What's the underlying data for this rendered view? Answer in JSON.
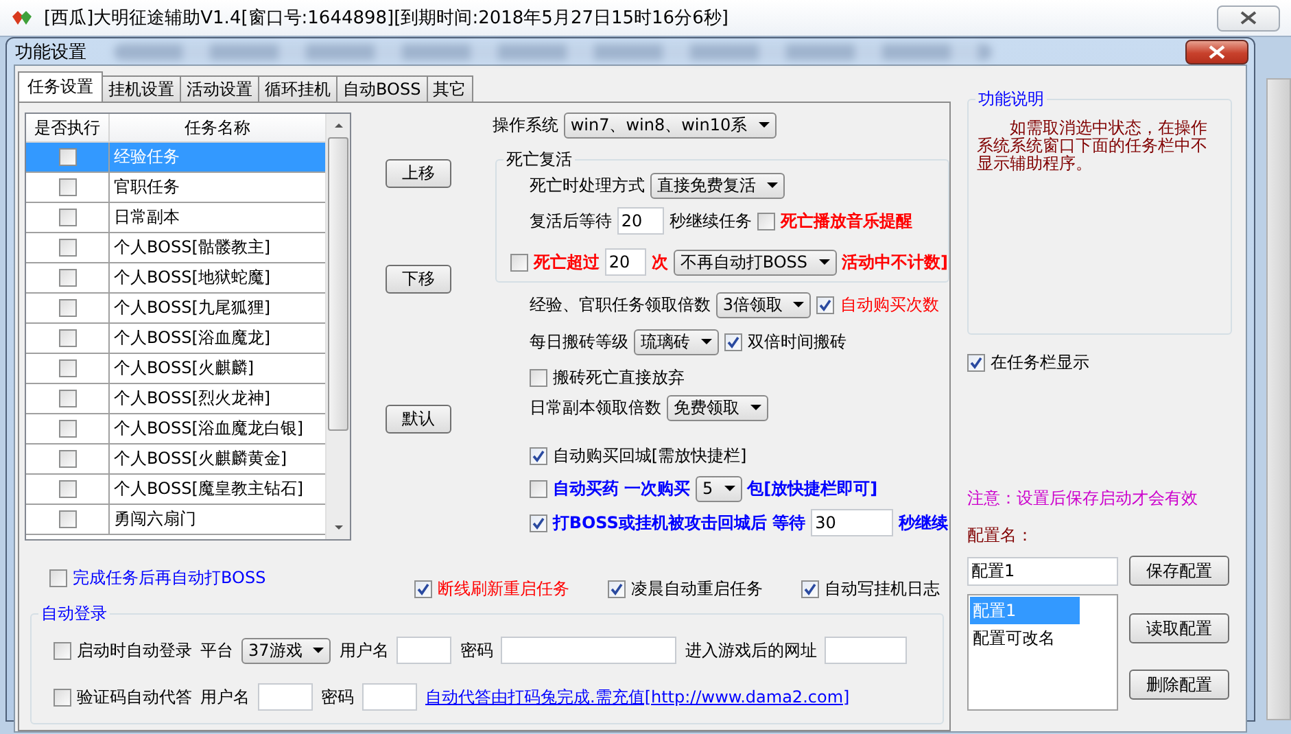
{
  "window": {
    "title": "[西瓜]大明征途辅助V1.4[窗口号:1644898][到期时间:2018年5月27日15时16分6秒]"
  },
  "dialog": {
    "title": "功能设置"
  },
  "tabs": [
    {
      "label": "任务设置",
      "selected": true
    },
    {
      "label": "挂机设置",
      "selected": false
    },
    {
      "label": "活动设置",
      "selected": false
    },
    {
      "label": "循环挂机",
      "selected": false
    },
    {
      "label": "自动BOSS",
      "selected": false
    },
    {
      "label": "其它",
      "selected": false
    }
  ],
  "task_table": {
    "columns": [
      "是否执行",
      "任务名称"
    ],
    "rows": [
      {
        "checked": false,
        "name": "经验任务",
        "selected": true
      },
      {
        "checked": false,
        "name": "官职任务",
        "selected": false
      },
      {
        "checked": false,
        "name": "日常副本",
        "selected": false
      },
      {
        "checked": false,
        "name": "个人BOSS[骷髅教主]",
        "selected": false
      },
      {
        "checked": false,
        "name": "个人BOSS[地狱蛇魔]",
        "selected": false
      },
      {
        "checked": false,
        "name": "个人BOSS[九尾狐狸]",
        "selected": false
      },
      {
        "checked": false,
        "name": "个人BOSS[浴血魔龙]",
        "selected": false
      },
      {
        "checked": false,
        "name": "个人BOSS[火麒麟]",
        "selected": false
      },
      {
        "checked": false,
        "name": "个人BOSS[烈火龙神]",
        "selected": false
      },
      {
        "checked": false,
        "name": "个人BOSS[浴血魔龙白银]",
        "selected": false
      },
      {
        "checked": false,
        "name": "个人BOSS[火麒麟黄金]",
        "selected": false
      },
      {
        "checked": false,
        "name": "个人BOSS[魔皇教主钻石]",
        "selected": false
      },
      {
        "checked": false,
        "name": "勇闯六扇门",
        "selected": false
      }
    ]
  },
  "move_buttons": [
    "上移",
    "下移",
    "默认"
  ],
  "finish_boss": {
    "label": "完成任务后再自动打BOSS",
    "checked": false,
    "color": "#0000ff"
  },
  "settings": [
    {
      "kind": "row",
      "parts": [
        {
          "kind": "label",
          "text": "操作系统"
        },
        {
          "kind": "select",
          "value": "win7、win8、win10系"
        }
      ]
    },
    {
      "kind": "group",
      "legend": "死亡复活",
      "rows": [
        {
          "parts": [
            {
              "kind": "label",
              "text": "死亡时处理方式"
            },
            {
              "kind": "select",
              "value": "直接免费复活"
            }
          ]
        },
        {
          "parts": [
            {
              "kind": "label",
              "text": "复活后等待"
            },
            {
              "kind": "input",
              "value": "20"
            },
            {
              "kind": "label",
              "text": "秒继续任务"
            },
            {
              "kind": "check",
              "checked": false,
              "label": "死亡播放音乐提醒",
              "color": "#ff0000",
              "bold": true
            }
          ]
        },
        {
          "parts": [
            {
              "kind": "check",
              "checked": false
            },
            {
              "kind": "label",
              "text": "死亡超过",
              "color": "#ff0000",
              "bold": true
            },
            {
              "kind": "input",
              "value": "20"
            },
            {
              "kind": "label",
              "text": "次",
              "color": "#ff0000",
              "bold": true
            },
            {
              "kind": "select",
              "value": "不再自动打BOSS"
            },
            {
              "kind": "label",
              "text": "活动中不计数]",
              "color": "#ff0000",
              "bold": true
            }
          ]
        }
      ]
    },
    {
      "kind": "row",
      "parts": [
        {
          "kind": "label",
          "text": "经验、官职任务领取倍数"
        },
        {
          "kind": "select",
          "value": "3倍领取"
        },
        {
          "kind": "check",
          "checked": true,
          "label": "自动购买次数",
          "color": "#ff0000"
        }
      ]
    },
    {
      "kind": "row",
      "parts": [
        {
          "kind": "label",
          "text": "每日搬砖等级"
        },
        {
          "kind": "select",
          "value": "琉璃砖"
        },
        {
          "kind": "check",
          "checked": true,
          "label": "双倍时间搬砖"
        }
      ]
    },
    {
      "kind": "row",
      "parts": [
        {
          "kind": "check",
          "checked": false,
          "label": "搬砖死亡直接放弃"
        }
      ]
    },
    {
      "kind": "row",
      "parts": [
        {
          "kind": "label",
          "text": "日常副本领取倍数"
        },
        {
          "kind": "select",
          "value": "免费领取"
        }
      ]
    },
    {
      "kind": "row",
      "parts": [
        {
          "kind": "check",
          "checked": true,
          "label": "自动购买回城[需放快捷栏]"
        }
      ]
    },
    {
      "kind": "row",
      "parts": [
        {
          "kind": "check",
          "checked": false,
          "label": "自动买药 一次购买",
          "color": "#0000ff",
          "bold": true
        },
        {
          "kind": "select",
          "value": "5"
        },
        {
          "kind": "label",
          "text": "包[放快捷栏即可]",
          "color": "#0000ff",
          "bold": true
        }
      ]
    },
    {
      "kind": "row",
      "parts": [
        {
          "kind": "check",
          "checked": true,
          "label": "打BOSS或挂机被攻击回城后 等待",
          "color": "#0000ff",
          "bold": true
        },
        {
          "kind": "input",
          "value": "30"
        },
        {
          "kind": "label",
          "text": "秒继续",
          "color": "#0000ff",
          "bold": true
        }
      ]
    }
  ],
  "restart_checks": [
    {
      "label": "断线刷新重启任务",
      "checked": true,
      "color": "#ff0000"
    },
    {
      "label": "凌晨自动重启任务",
      "checked": true,
      "color": "#000000"
    },
    {
      "label": "自动写挂机日志",
      "checked": true,
      "color": "#000000"
    }
  ],
  "auto_login": {
    "legend": "自动登录",
    "rows": [
      {
        "parts": [
          {
            "kind": "check",
            "checked": false,
            "label": "启动时自动登录"
          },
          {
            "kind": "label",
            "text": "平台"
          },
          {
            "kind": "select",
            "value": "37游戏"
          },
          {
            "kind": "label",
            "text": "用户名"
          },
          {
            "kind": "input"
          },
          {
            "kind": "label",
            "text": "密码"
          },
          {
            "kind": "input"
          },
          {
            "kind": "label",
            "text": "进入游戏后的网址"
          },
          {
            "kind": "input"
          }
        ]
      },
      {
        "parts": [
          {
            "kind": "check",
            "checked": false,
            "label": "验证码自动代答"
          },
          {
            "kind": "label",
            "text": "用户名"
          },
          {
            "kind": "input"
          },
          {
            "kind": "label",
            "text": "密码"
          },
          {
            "kind": "input"
          },
          {
            "kind": "link",
            "text": "自动代答由打码兔完成.需充值[http://www.dama2.com]"
          }
        ]
      }
    ]
  },
  "info": {
    "legend": "功能说明",
    "text": "如需取消选中状态，在操作系统系统窗口下面的任务栏中不显示辅助程序。"
  },
  "show_in_taskbar": {
    "label": "在任务栏显示",
    "checked": true
  },
  "notice": "注意：设置后保存启动才会有效",
  "config": {
    "label": "配置名：",
    "name_value": "配置1",
    "save_button": "保存配置",
    "load_button": "读取配置",
    "delete_button": "删除配置",
    "items": [
      {
        "label": "配置1",
        "selected": true
      },
      {
        "label": "配置可改名",
        "selected": false
      }
    ]
  }
}
